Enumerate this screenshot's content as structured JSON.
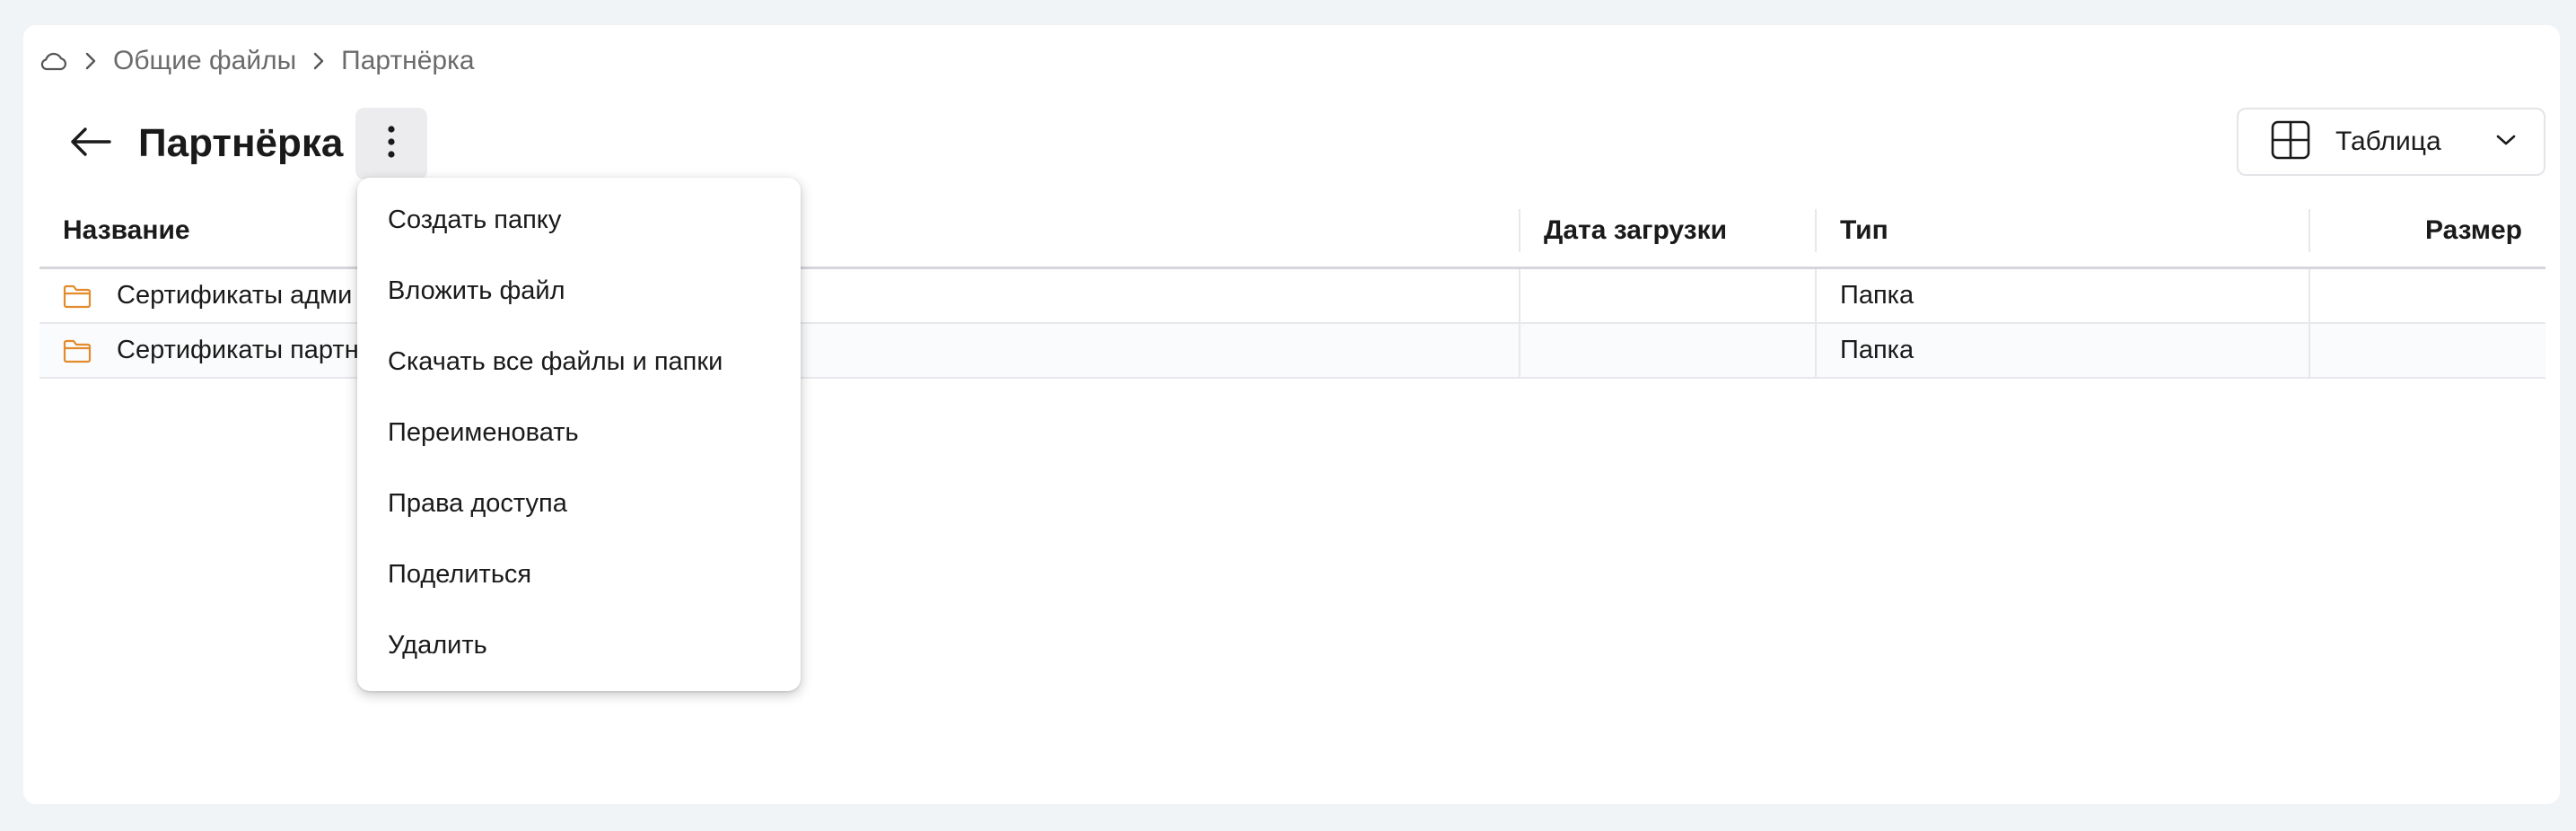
{
  "breadcrumb": {
    "root_icon": "cloud-icon",
    "items": [
      "Общие файлы",
      "Партнёрка"
    ]
  },
  "header": {
    "title": "Партнёрка",
    "back_icon": "arrow-left-icon",
    "more_icon": "more-vertical-icon"
  },
  "view_select": {
    "icon": "table-grid-icon",
    "label": "Таблица"
  },
  "table": {
    "columns": [
      "Название",
      "Дата загрузки",
      "Тип",
      "Размер"
    ],
    "rows": [
      {
        "name": "Сертификаты адми",
        "date": "",
        "type": "Папка",
        "size": ""
      },
      {
        "name": "Сертификаты партн",
        "date": "",
        "type": "Папка",
        "size": ""
      }
    ]
  },
  "menu": {
    "items": [
      "Создать папку",
      "Вложить файл",
      "Скачать все файлы и папки",
      "Переименовать",
      "Права доступа",
      "Поделиться",
      "Удалить"
    ]
  },
  "colors": {
    "folder": "#e38a2b",
    "page_bg": "#f1f4f7"
  }
}
